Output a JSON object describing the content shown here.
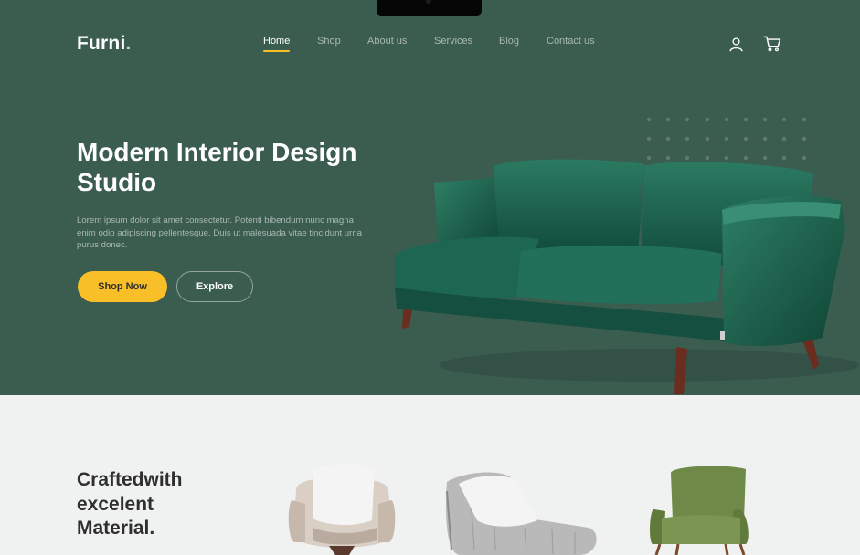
{
  "brand": {
    "name": "Furni",
    "dot": "."
  },
  "nav": {
    "items": [
      {
        "label": "Home",
        "active": true
      },
      {
        "label": "Shop",
        "active": false
      },
      {
        "label": "About us",
        "active": false
      },
      {
        "label": "Services",
        "active": false
      },
      {
        "label": "Blog",
        "active": false
      },
      {
        "label": "Contact us",
        "active": false
      }
    ]
  },
  "header_icons": {
    "account": "user-icon",
    "cart": "cart-icon"
  },
  "hero": {
    "title_line1": "Modern Interior Design",
    "title_line2": "Studio",
    "description": "Lorem ipsum dolor sit amet consectetur. Potenti bibendum nunc magna enim odio adipiscing pellentesque. Duis ut malesuada vitae tincidunt urna purus donec.",
    "primary_button": "Shop Now",
    "secondary_button": "Explore",
    "image": "green-velvet-sofa"
  },
  "craft_section": {
    "title_line1": "Craftedwith",
    "title_line2": "excelent",
    "title_line3": "Material.",
    "products": [
      "beige-armchair-with-pillow",
      "grey-lounge-chair-with-pillow",
      "olive-green-armchair"
    ]
  },
  "colors": {
    "hero_bg": "#3b5d50",
    "accent": "#f9bf29",
    "section_bg": "#eff2f1",
    "text_dark": "#2f2f2f"
  }
}
